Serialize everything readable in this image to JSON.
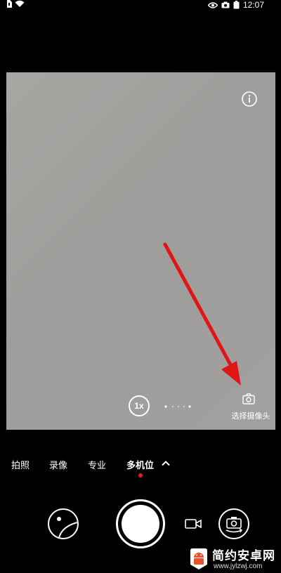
{
  "status_bar": {
    "time": "12:07",
    "left_icons": [
      "sim-icon",
      "wifi-icon"
    ],
    "right_icons": [
      "eye-icon",
      "camera-notification-icon"
    ]
  },
  "viewfinder": {
    "zoom_label": "1x",
    "select_camera_label": "选择摄像头",
    "annotation_arrow_color": "#e01515"
  },
  "modes": {
    "items": [
      {
        "label": "拍照"
      },
      {
        "label": "录像"
      },
      {
        "label": "专业"
      },
      {
        "label": "多机位"
      }
    ],
    "active": "多机位",
    "indicator_color": "#e02020"
  },
  "controls": {
    "gallery": "gallery-thumbnail",
    "shutter": "shutter",
    "video": "video-icon",
    "switch_camera": "switch-camera-icon"
  },
  "watermark": {
    "title": "简约安卓网",
    "url": "www.jylzwj.com"
  }
}
